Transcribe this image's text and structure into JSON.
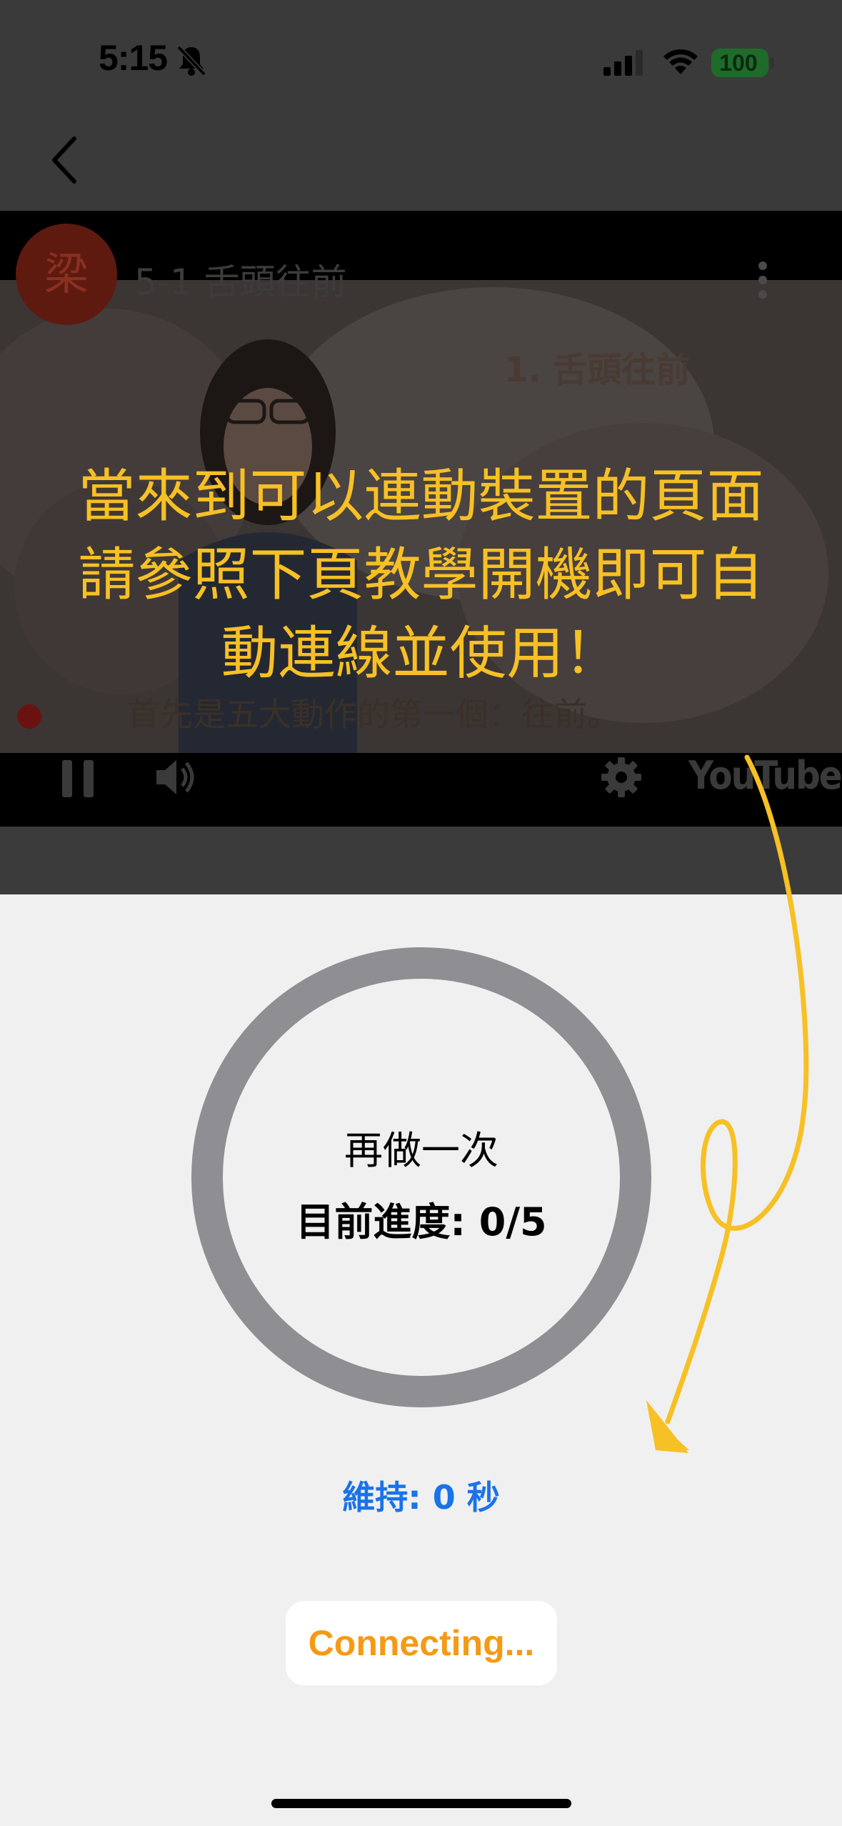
{
  "status_bar": {
    "time": "5:15",
    "battery": "100",
    "icons": [
      "bell-slash-icon",
      "cellular-signal-icon",
      "wifi-icon",
      "battery-icon"
    ]
  },
  "nav": {
    "back_icon": "chevron-left-icon"
  },
  "video": {
    "channel_avatar": "梁",
    "title": "5-1 舌頭往前",
    "slide_heading": "1. 舌頭往前",
    "subtitle": "首先是五大動作的第一個：往前。",
    "brand": "YouTube",
    "controls": [
      "pause-icon",
      "volume-icon",
      "settings-icon"
    ]
  },
  "overlay": {
    "lines": [
      "當來到可以連動裝置的頁面",
      "請參照下頁教學開機即可自",
      "動連線並使用！"
    ],
    "color": "#f7c024"
  },
  "exercise": {
    "prompt": "再做一次",
    "progress_text": "目前進度: 0/5",
    "progress_fraction": 0,
    "hold_text": "維持: 0 秒",
    "connect_button": "Connecting..."
  },
  "colors": {
    "ring": "#8e8e93",
    "hold": "#1a73e8",
    "connect": "#f59a14",
    "background": "#f0f0f0"
  }
}
